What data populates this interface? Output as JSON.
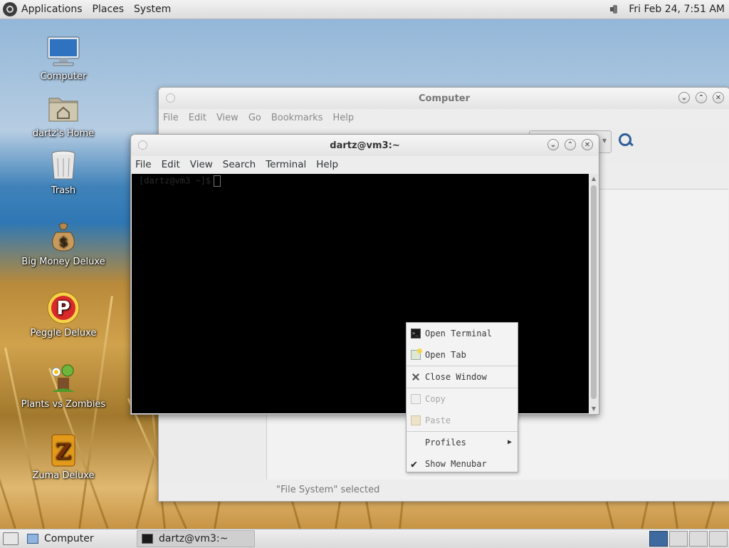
{
  "top_panel": {
    "menus": [
      "Applications",
      "Places",
      "System"
    ],
    "clock": "Fri Feb 24,  7:51 AM"
  },
  "desktop_icons": [
    {
      "label": "Computer",
      "icon": "computer-icon"
    },
    {
      "label": "dartz's Home",
      "icon": "home-folder-icon"
    },
    {
      "label": "Trash",
      "icon": "trash-icon"
    },
    {
      "label": "Big Money Deluxe",
      "icon": "money-bag-icon"
    },
    {
      "label": "Peggle Deluxe",
      "icon": "peggle-icon"
    },
    {
      "label": "Plants vs Zombies",
      "icon": "plants-vs-zombies-icon"
    },
    {
      "label": "Zuma Deluxe",
      "icon": "zuma-icon"
    }
  ],
  "computer_window": {
    "title": "Computer",
    "menu": [
      "File",
      "Edit",
      "View",
      "Go",
      "Bookmarks",
      "Help"
    ],
    "status": "\"File System\" selected"
  },
  "terminal_window": {
    "title": "dartz@vm3:~",
    "menu": [
      "File",
      "Edit",
      "View",
      "Search",
      "Terminal",
      "Help"
    ],
    "prompt": "[dartz@vm3 ~]$"
  },
  "context_menu": {
    "items": [
      {
        "label": "Open Terminal",
        "icon": "terminal-icon",
        "enabled": true
      },
      {
        "label": "Open Tab",
        "icon": "new-tab-icon",
        "enabled": true
      },
      {
        "label": "Close Window",
        "icon": "close-icon",
        "enabled": true
      },
      {
        "label": "Copy",
        "icon": "copy-icon",
        "enabled": false
      },
      {
        "label": "Paste",
        "icon": "paste-icon",
        "enabled": false
      },
      {
        "label": "Profiles",
        "icon": "",
        "enabled": true,
        "submenu": true
      },
      {
        "label": "Show Menubar",
        "icon": "check-icon",
        "enabled": true,
        "checked": true
      }
    ]
  },
  "taskbar": {
    "tasks": [
      {
        "label": "Computer",
        "icon": "file-manager-icon",
        "active": false
      },
      {
        "label": "dartz@vm3:~",
        "icon": "terminal-icon",
        "active": true
      }
    ],
    "workspaces": 4,
    "active_workspace": 1
  }
}
